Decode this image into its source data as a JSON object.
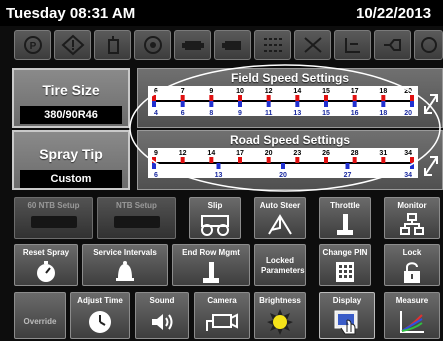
{
  "header": {
    "day_time": "Tuesday 08:31 AM",
    "date": "10/22/2013"
  },
  "warning_icons": [
    "parking-brake-icon",
    "warning-triangle-icon",
    "fuel-filter-icon",
    "tank-icon",
    "engine-icon",
    "engine-alt-icon",
    "transmission-icon",
    "hydraulic-icon",
    "pump-icon",
    "flow-icon",
    "oil-can-icon"
  ],
  "tire_size": {
    "label": "Tire Size",
    "value": "380/90R46"
  },
  "spray_tip": {
    "label": "Spray Tip",
    "value": "Custom"
  },
  "field_speed": {
    "title": "Field Speed Settings",
    "top_ticks": [
      "6",
      "7",
      "9",
      "10",
      "12",
      "14",
      "15",
      "17",
      "18",
      "20"
    ],
    "bottom_ticks": [
      "4",
      "6",
      "8",
      "9",
      "11",
      "13",
      "15",
      "16",
      "18",
      "20"
    ]
  },
  "road_speed": {
    "title": "Road Speed Settings",
    "top_ticks": [
      "9",
      "12",
      "14",
      "17",
      "20",
      "23",
      "26",
      "28",
      "31",
      "34"
    ],
    "bottom_ticks": [
      "6",
      "13",
      "20",
      "27",
      "34"
    ]
  },
  "buttons": {
    "ntb60": "60 NTB Setup",
    "ntb": "NTB Setup",
    "slip": "Slip",
    "auto_steer": "Auto Steer",
    "throttle": "Throttle",
    "monitor": "Monitor",
    "reset_spray": "Reset Spray",
    "service_intervals": "Service Intervals",
    "end_row": "End Row Mgmt",
    "locked_params": "Locked Parameters",
    "change_pin": "Change PIN",
    "lock": "Lock",
    "override": "Override",
    "adjust_time": "Adjust Time",
    "sound": "Sound",
    "camera": "Camera",
    "brightness": "Brightness",
    "display": "Display",
    "measure": "Measure"
  },
  "colors": {
    "red_marker": "#e01010",
    "blue_marker": "#2030d0",
    "panel_border": "#c9c9c9"
  }
}
